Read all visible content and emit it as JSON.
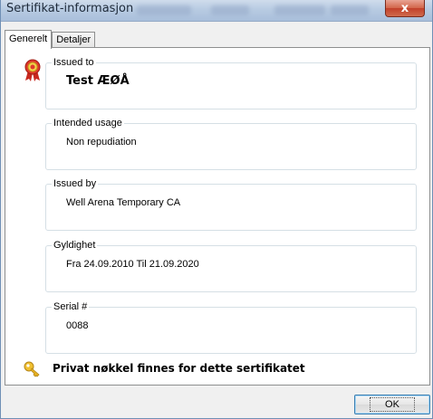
{
  "window": {
    "title": "Sertifikat-informasjon",
    "close_label": "x"
  },
  "tabs": [
    {
      "label": "Generelt",
      "active": true
    },
    {
      "label": "Detaljer",
      "active": false
    }
  ],
  "fields": {
    "issued_to": {
      "label": "Issued to",
      "value": "Test ÆØÅ"
    },
    "intended_usage": {
      "label": "Intended usage",
      "value": "Non repudiation"
    },
    "issued_by": {
      "label": "Issued by",
      "value": "Well Arena Temporary CA"
    },
    "validity": {
      "label": "Gyldighet",
      "value": "Fra 24.09.2010 Til 21.09.2020"
    },
    "serial": {
      "label": "Serial #",
      "value": "0088"
    }
  },
  "private_key_notice": "Privat nøkkel finnes for dette sertifikatet",
  "ok_label": "OK",
  "icons": {
    "certificate": "certificate-ribbon-icon",
    "key": "key-icon"
  },
  "colors": {
    "titlebar": "#b8cbe2",
    "close": "#c2402a",
    "ribbon": "#d8342a",
    "key": "#e6b020",
    "group_border": "#d5dfe5"
  }
}
